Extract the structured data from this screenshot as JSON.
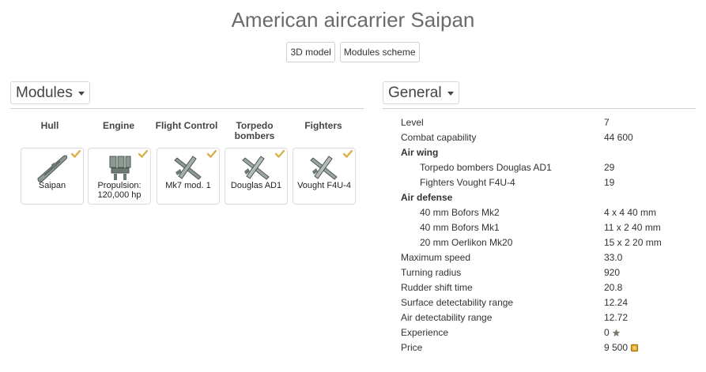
{
  "header": {
    "title": "American aircarrier Saipan",
    "btn_3d": "3D model",
    "btn_modules": "Modules scheme"
  },
  "modules": {
    "label": "Modules",
    "columns": [
      {
        "header": "Hull",
        "card": "Saipan"
      },
      {
        "header": "Engine",
        "card": "Propulsion: 120,000 hp"
      },
      {
        "header": "Flight Control",
        "card": "Mk7 mod. 1"
      },
      {
        "header": "Torpedo bombers",
        "card": "Douglas AD1"
      },
      {
        "header": "Fighters",
        "card": "Vought F4U-4"
      }
    ]
  },
  "general": {
    "label": "General",
    "rows": [
      {
        "k": "Level",
        "v": "7"
      },
      {
        "k": "Combat capability",
        "v": "44 600"
      },
      {
        "k": "Air wing",
        "v": ""
      },
      {
        "k": "Torpedo bombers Douglas AD1",
        "v": "29"
      },
      {
        "k": "Fighters Vought F4U-4",
        "v": "19"
      },
      {
        "k": "Air defense",
        "v": ""
      },
      {
        "k": "40 mm Bofors Mk2",
        "v": "4 x 4 40 mm"
      },
      {
        "k": "40 mm Bofors Mk1",
        "v": "11 x 2 40 mm"
      },
      {
        "k": "20 mm Oerlikon Mk20",
        "v": "15 x 2 20 mm"
      },
      {
        "k": "Maximum speed",
        "v": "33.0"
      },
      {
        "k": "Turning radius",
        "v": "920"
      },
      {
        "k": "Rudder shift time",
        "v": "20.8"
      },
      {
        "k": "Surface detectability range",
        "v": "12.24"
      },
      {
        "k": "Air detectability range",
        "v": "12.72"
      },
      {
        "k": "Experience",
        "v": "0"
      },
      {
        "k": "Price",
        "v": "9 500"
      }
    ]
  },
  "icons": {
    "check": "checkmark-icon",
    "hull": "ship-icon",
    "engine": "engine-icon",
    "plane": "plane-icon",
    "experience": "star-icon",
    "price": "credits-icon"
  },
  "colors": {
    "check": "#d9b14a",
    "icon_grey": "#8d9a92"
  }
}
